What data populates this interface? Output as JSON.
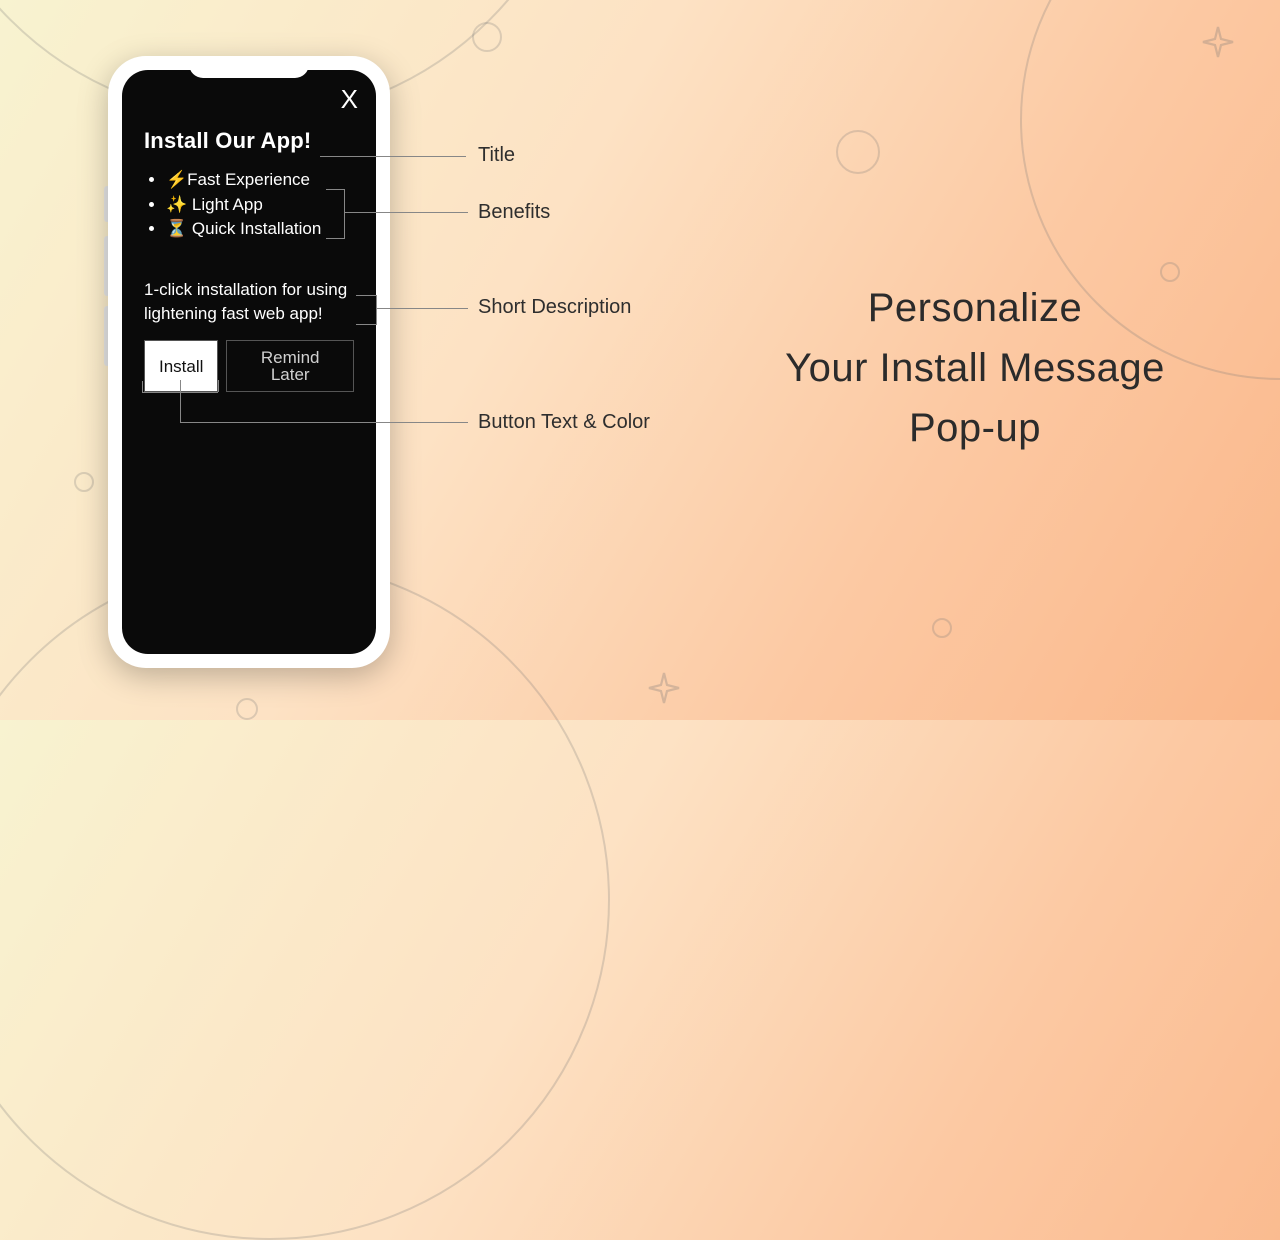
{
  "popup": {
    "close_label": "X",
    "title": "Install Our App!",
    "benefits": [
      "⚡Fast Experience",
      "✨ Light App",
      "⏳ Quick Installation"
    ],
    "short_description": "1-click installation for using lightening fast web app!",
    "install_label": "Install",
    "remind_label": "Remind Later"
  },
  "callouts": {
    "title": "Title",
    "benefits": "Benefits",
    "short_description": "Short Description",
    "button_text_color": "Button Text & Color"
  },
  "headline": {
    "line1": "Personalize",
    "line2": "Your Install Message",
    "line3": "Pop-up"
  }
}
